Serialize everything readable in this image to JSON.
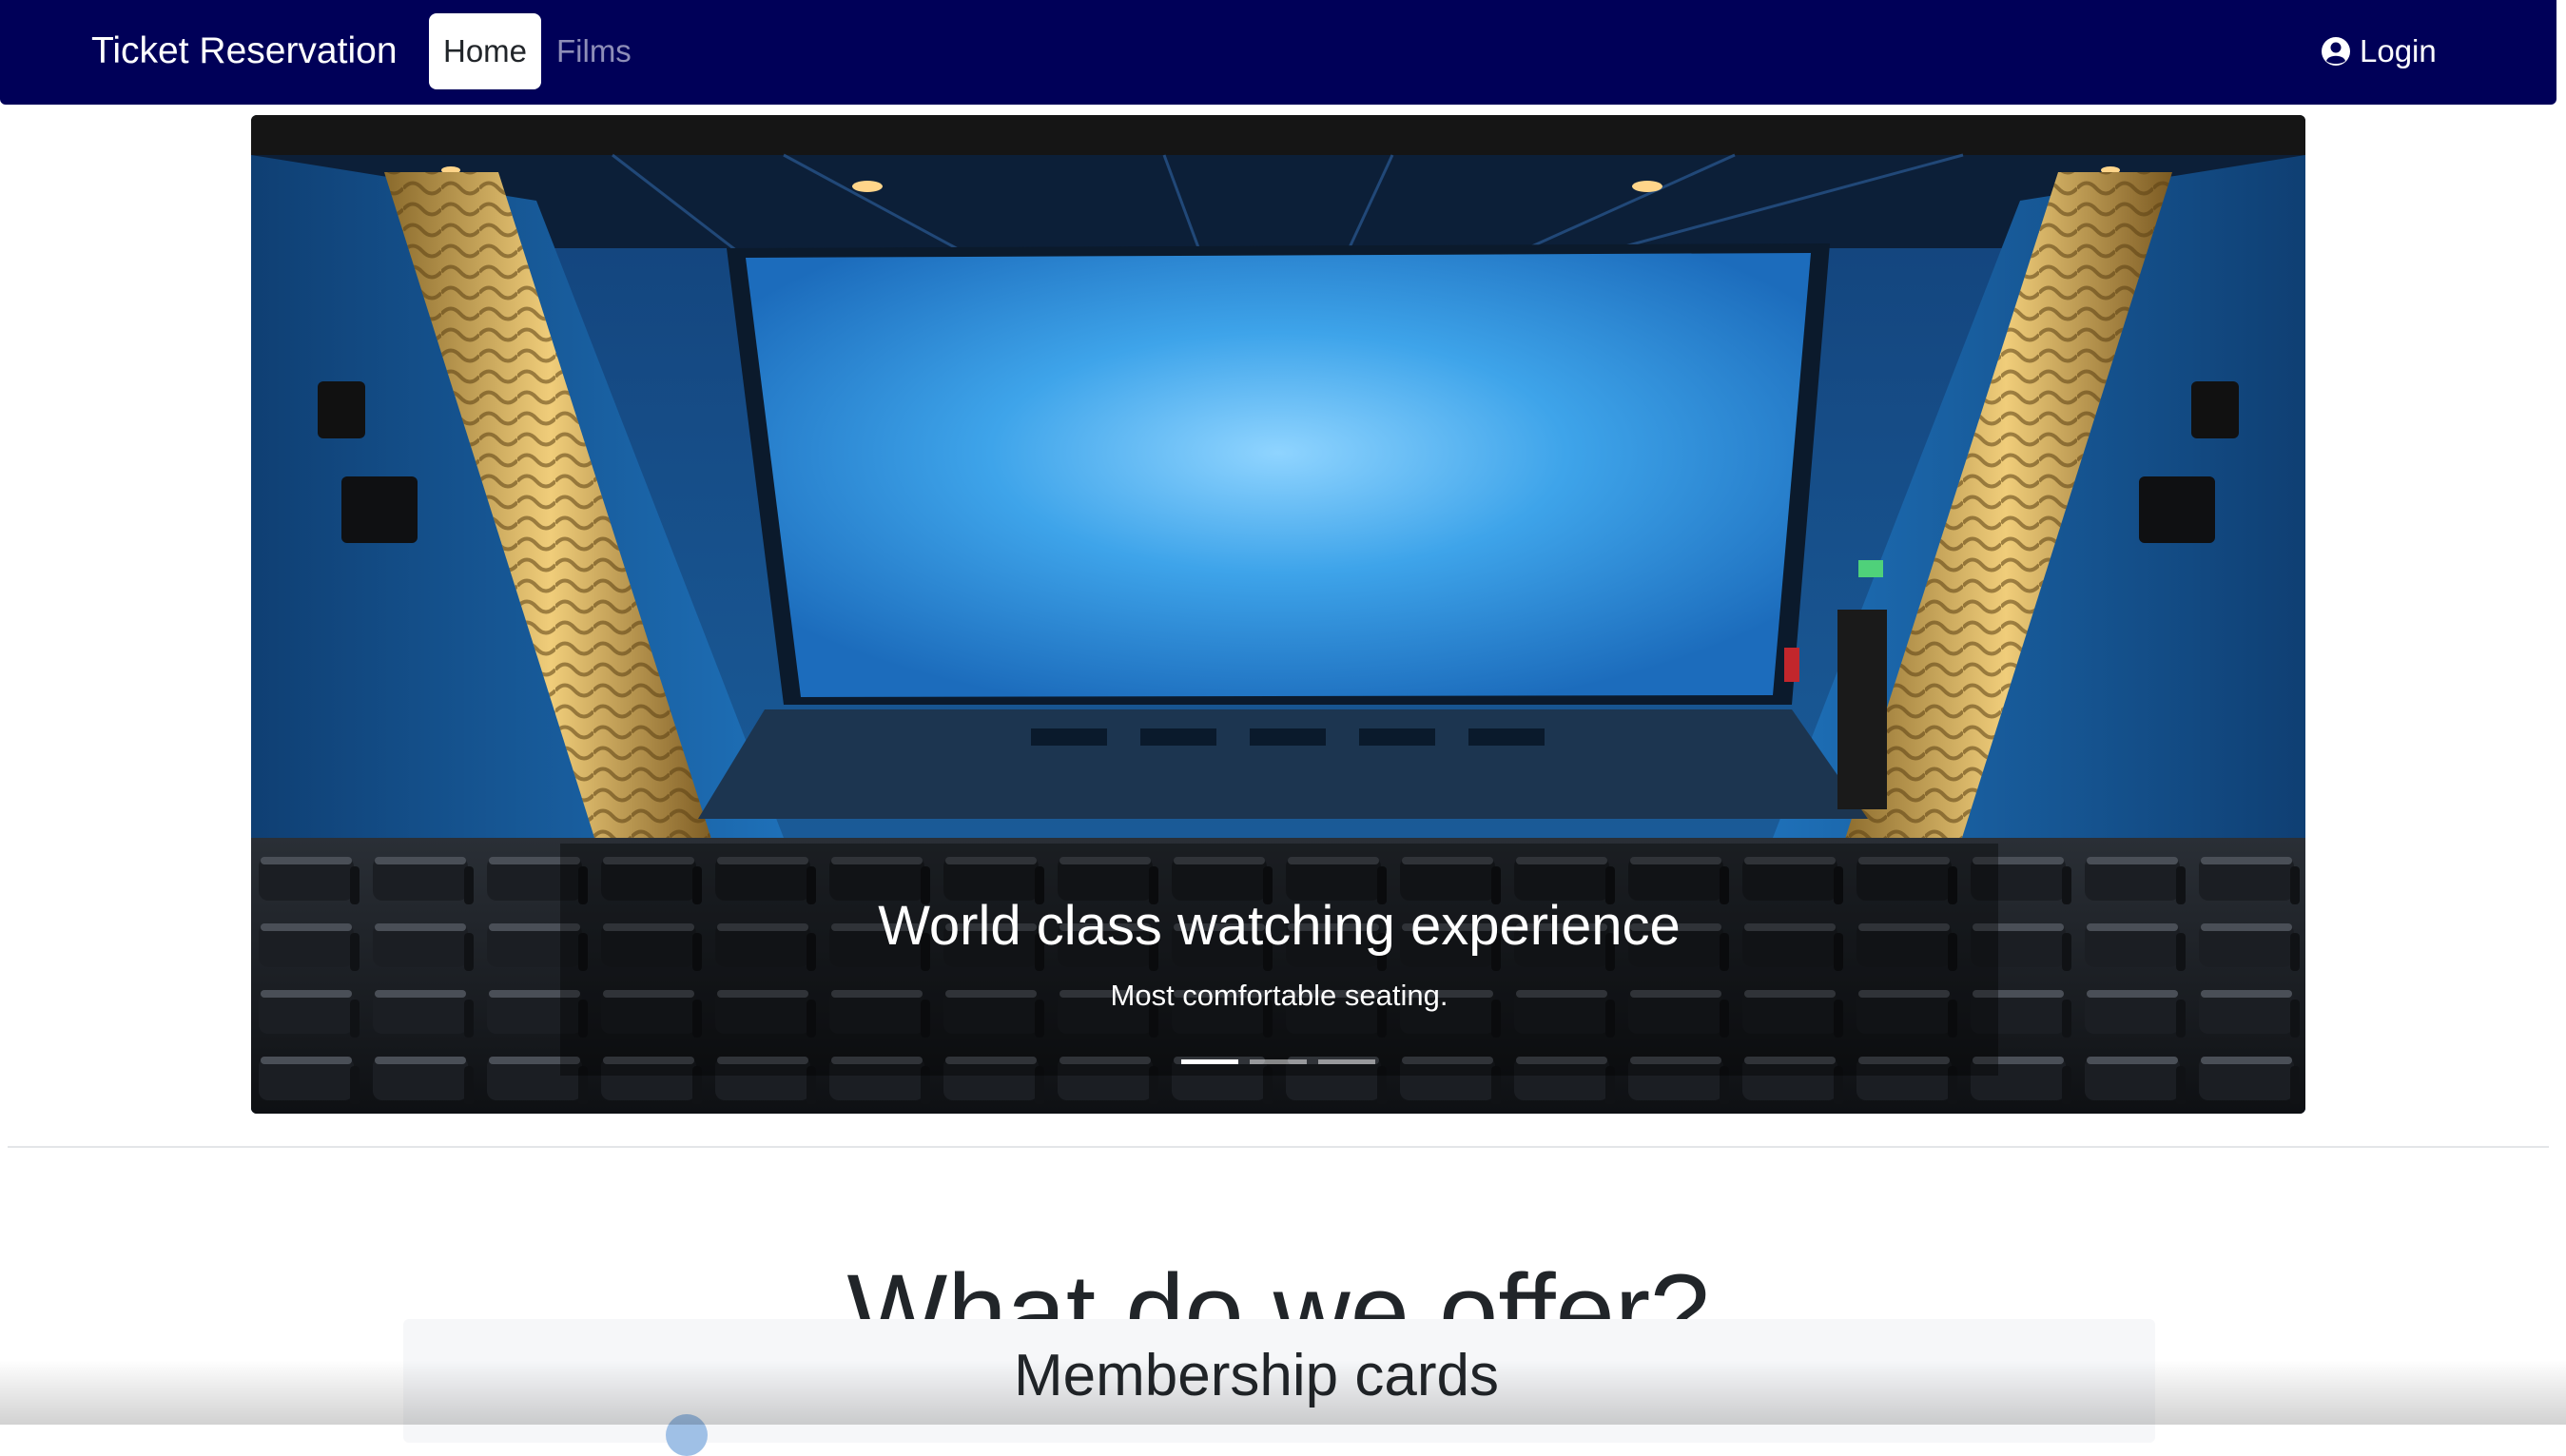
{
  "navbar": {
    "brand": "Ticket Reservation",
    "items": [
      {
        "label": "Home",
        "active": true
      },
      {
        "label": "Films",
        "active": false
      }
    ],
    "login_label": "Login",
    "background": "#000058",
    "login_icon": "user-circle-icon"
  },
  "carousel": {
    "slide_image": "cinema-auditorium-photo",
    "caption_title": "World class watching experience",
    "caption_text": "Most comfortable seating.",
    "slide_count": 3,
    "active_slide": 1
  },
  "offer_section": {
    "title": "What do we offer?",
    "cards": [
      {
        "title": "Membership cards"
      }
    ]
  }
}
